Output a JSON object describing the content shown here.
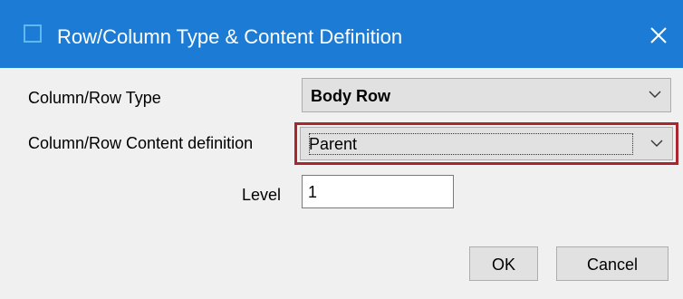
{
  "window": {
    "title": "Row/Column Type & Content Definition",
    "icon": "window-icon",
    "close_icon": "close-icon",
    "accent_color": "#1c7cd5"
  },
  "form": {
    "type_label": "Column/Row Type",
    "type_value": "Body Row",
    "content_label": "Column/Row Content definition",
    "content_value": "Parent",
    "level_label": "Level",
    "level_value": "1",
    "highlight_color": "#a8262c"
  },
  "buttons": {
    "ok_label": "OK",
    "cancel_label": "Cancel"
  }
}
